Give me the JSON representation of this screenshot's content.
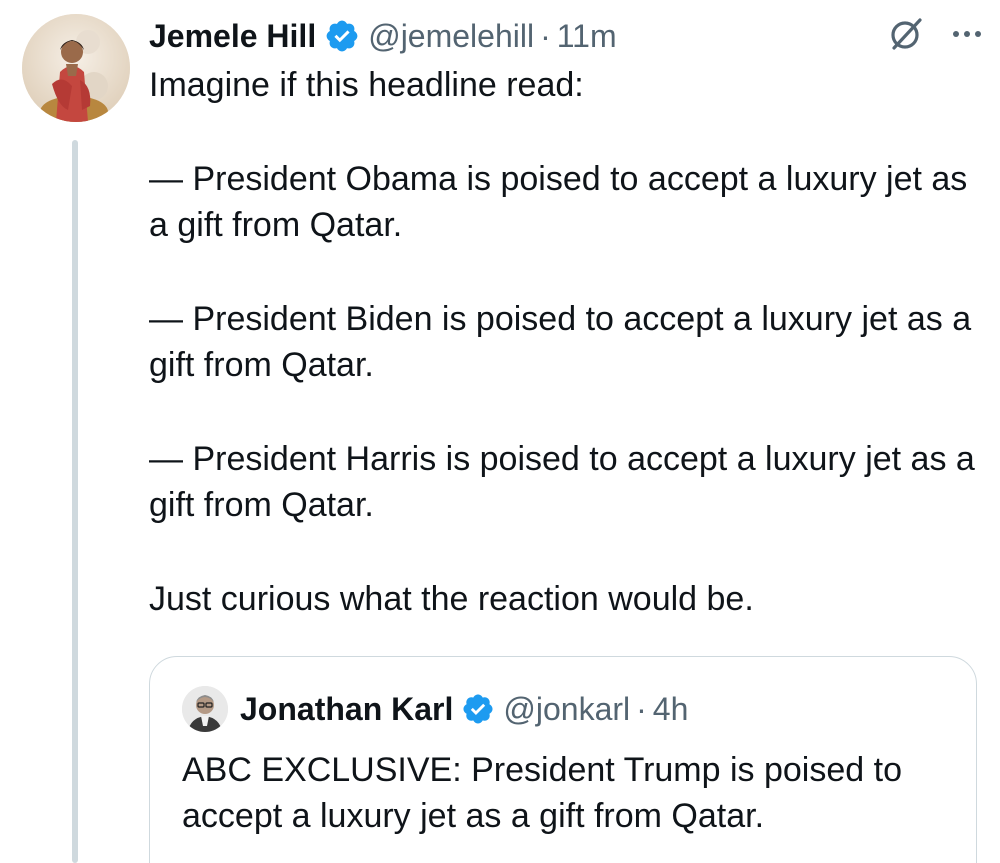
{
  "tweet": {
    "author_name": "Jemele Hill",
    "handle": "@jemelehill",
    "separator": "·",
    "time": "11m",
    "paragraphs": [
      "Imagine if this headline read:",
      "— President Obama is poised to accept a luxury jet as a gift from Qatar.",
      "— President Biden is poised to accept a luxury jet as a gift from Qatar.",
      "— President Harris is poised to accept a luxury jet as a gift from Qatar.",
      "Just curious what the reaction would be."
    ]
  },
  "quoted_tweet": {
    "author_name": "Jonathan Karl",
    "handle": "@jonkarl",
    "separator": "·",
    "time": "4h",
    "text": "ABC EXCLUSIVE: President Trump is poised to accept a luxury jet as a gift from Qatar."
  },
  "icons": {
    "verified": "verified-badge-icon",
    "grok": "grok-icon",
    "more": "more-options-icon"
  },
  "colors": {
    "verified_blue": "#1d9bf0",
    "text_primary": "#0f1419",
    "text_secondary": "#536471",
    "border": "#cfd9de"
  }
}
